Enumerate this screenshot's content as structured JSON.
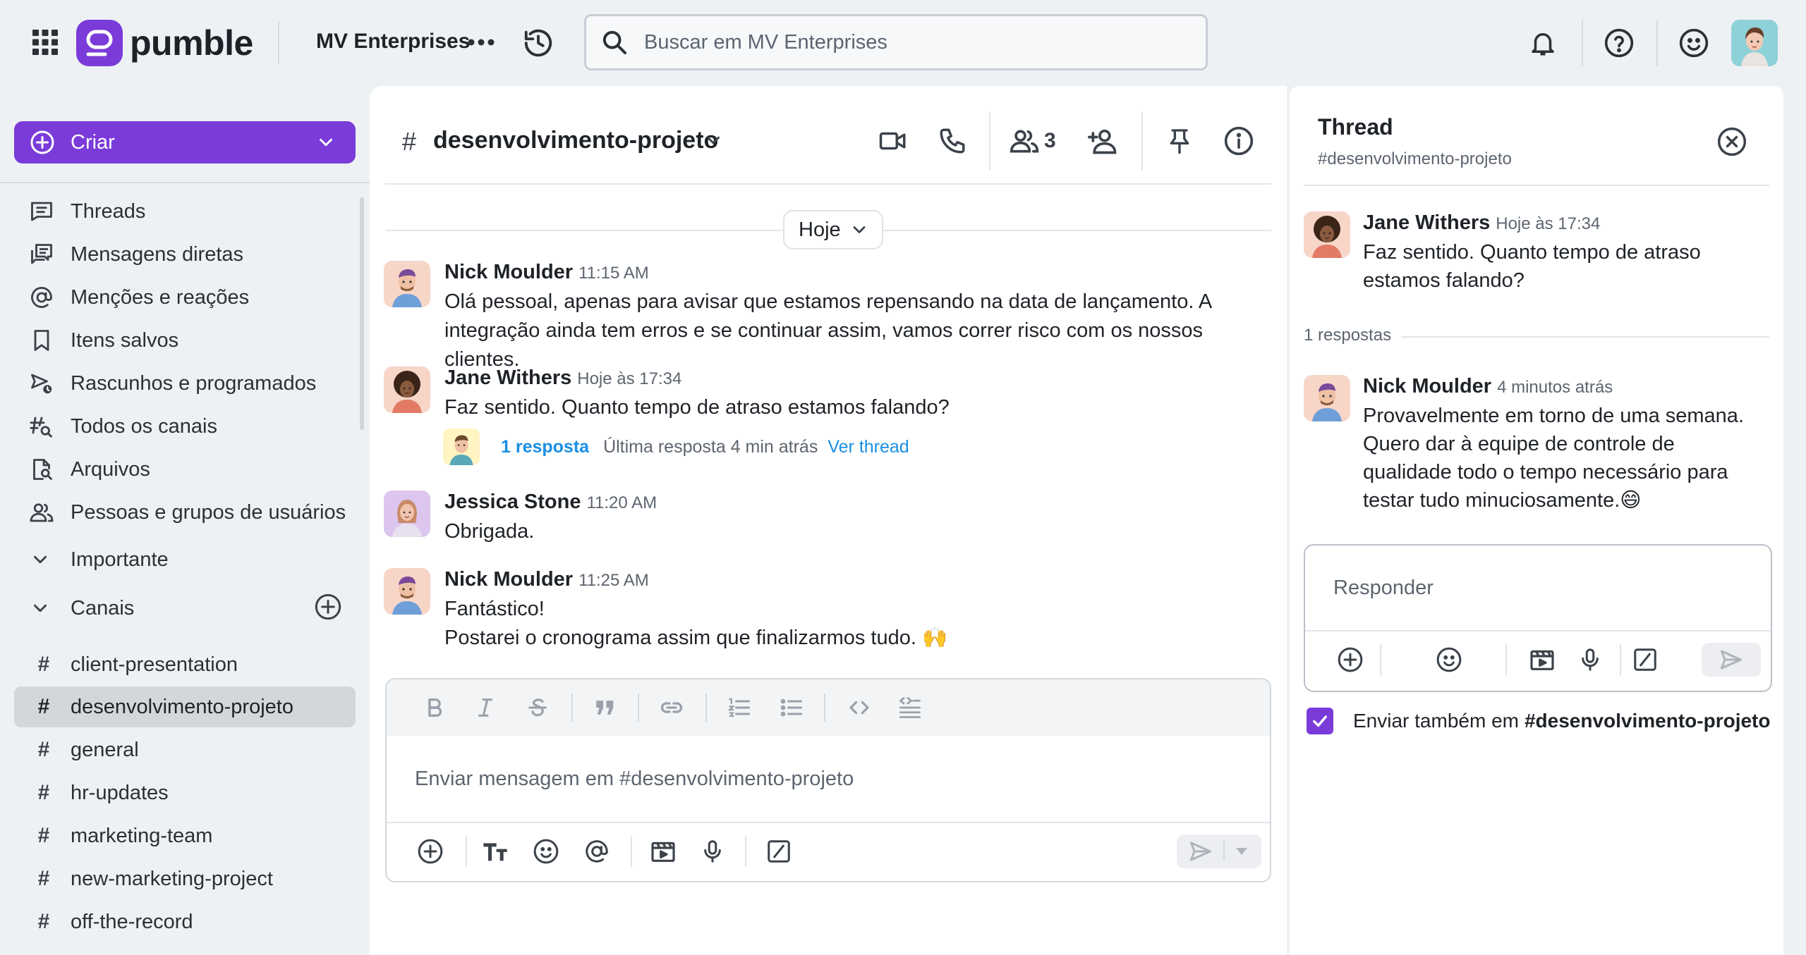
{
  "topbar": {
    "brand": "pumble",
    "workspace": "MV Enterprises",
    "search_placeholder": "Buscar em MV Enterprises"
  },
  "sidebar": {
    "create_label": "Criar",
    "nav": [
      {
        "label": "Threads",
        "icon": "threads-icon"
      },
      {
        "label": "Mensagens diretas",
        "icon": "direct-messages-icon"
      },
      {
        "label": "Menções e reações",
        "icon": "at-sign-icon"
      },
      {
        "label": "Itens salvos",
        "icon": "bookmark-icon"
      },
      {
        "label": "Rascunhos e programados",
        "icon": "drafts-icon"
      },
      {
        "label": "Todos os canais",
        "icon": "channel-search-icon"
      },
      {
        "label": "Arquivos",
        "icon": "file-search-icon"
      },
      {
        "label": "Pessoas e grupos de usuários",
        "icon": "people-icon"
      }
    ],
    "section_important": "Importante",
    "section_channels": "Canais",
    "channels": [
      {
        "name": "client-presentation",
        "active": false
      },
      {
        "name": "desenvolvimento-projeto",
        "active": true
      },
      {
        "name": "general",
        "active": false
      },
      {
        "name": "hr-updates",
        "active": false
      },
      {
        "name": "marketing-team",
        "active": false
      },
      {
        "name": "new-marketing-project",
        "active": false
      },
      {
        "name": "off-the-record",
        "active": false
      }
    ]
  },
  "channel": {
    "hash": "#",
    "name": "desenvolvimento-projeto",
    "member_count": "3",
    "date_divider": "Hoje",
    "messages": [
      {
        "author": "Nick Moulder",
        "time": "11:15 AM",
        "text": "Olá pessoal, apenas para avisar que estamos repensando na data de lançamento. A integração ainda tem erros e se continuar assim, vamos correr risco com os nossos clientes."
      },
      {
        "author": "Jane Withers",
        "time": "Hoje às 17:34",
        "text": "Faz sentido. Quanto tempo de atraso estamos falando?"
      },
      {
        "author": "Jessica Stone",
        "time": "11:20 AM",
        "text": "Obrigada."
      },
      {
        "author": "Nick Moulder",
        "time": "11:25 AM",
        "text_line1": "Fantástico!",
        "text_line2": "Postarei o cronograma assim que finalizarmos tudo. 🙌"
      }
    ],
    "thread_summary": {
      "count": "1 resposta",
      "last": "Última resposta 4 min atrás",
      "view": "Ver thread"
    },
    "composer_placeholder": "Enviar mensagem em #desenvolvimento-projeto"
  },
  "thread": {
    "title": "Thread",
    "channel": "#desenvolvimento-projeto",
    "parent": {
      "author": "Jane Withers",
      "time": "Hoje às 17:34",
      "text": "Faz sentido. Quanto tempo de atraso estamos falando?"
    },
    "replies_label": "1 respostas",
    "reply": {
      "author": "Nick Moulder",
      "time": "4 minutos atrás",
      "text": "Provavelmente em torno de uma semana. Quero dar à equipe de controle de qualidade todo o tempo necessário para testar tudo minuciosamente.😄"
    },
    "reply_placeholder": "Responder",
    "also_send_label": "Enviar também em",
    "also_send_channel": "#desenvolvimento-projeto"
  },
  "colors": {
    "brand_purple": "#7b3bd9",
    "link_blue": "#1a8fe3",
    "active_channel_bg": "#d2d7dc"
  }
}
